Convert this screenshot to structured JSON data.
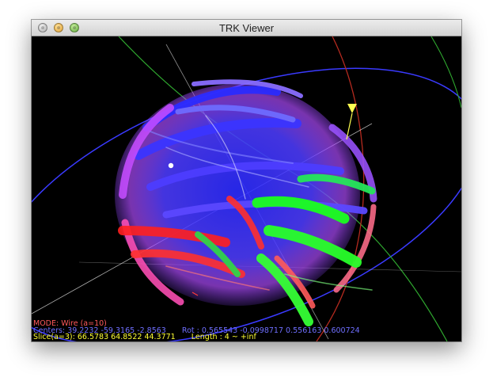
{
  "window": {
    "title": "TRK Viewer"
  },
  "viewer": {
    "mode_text": "MODE: Wire (a=10)",
    "centers_text": "Centers: 39.2232 -59.3165 -2.8563",
    "rot_text": "Rot : 0.565543 -0.0998717 0.556163 0.600724",
    "slice_text": "Slice(a=3): 66.5783 64.8522 44.3771",
    "length_text": "Length : 4 ~ +inf"
  },
  "colors": {
    "mode_text": "#ff5a5a",
    "centers_text": "#6f6fff",
    "slice_text": "#ffff33",
    "ring_x": "#3a3aff",
    "ring_y": "#2fa82f",
    "ring_z": "#b52a1f",
    "fiber_red": "#ff2020",
    "fiber_green": "#28ff2a",
    "fiber_blue": "#2a2aff",
    "fiber_magenta": "#d23cff",
    "cursor_marker": "#ffff50"
  },
  "icons": {
    "close": "close-button-icon",
    "minimize": "minimize-button-icon",
    "maximize": "maximize-button-icon"
  }
}
